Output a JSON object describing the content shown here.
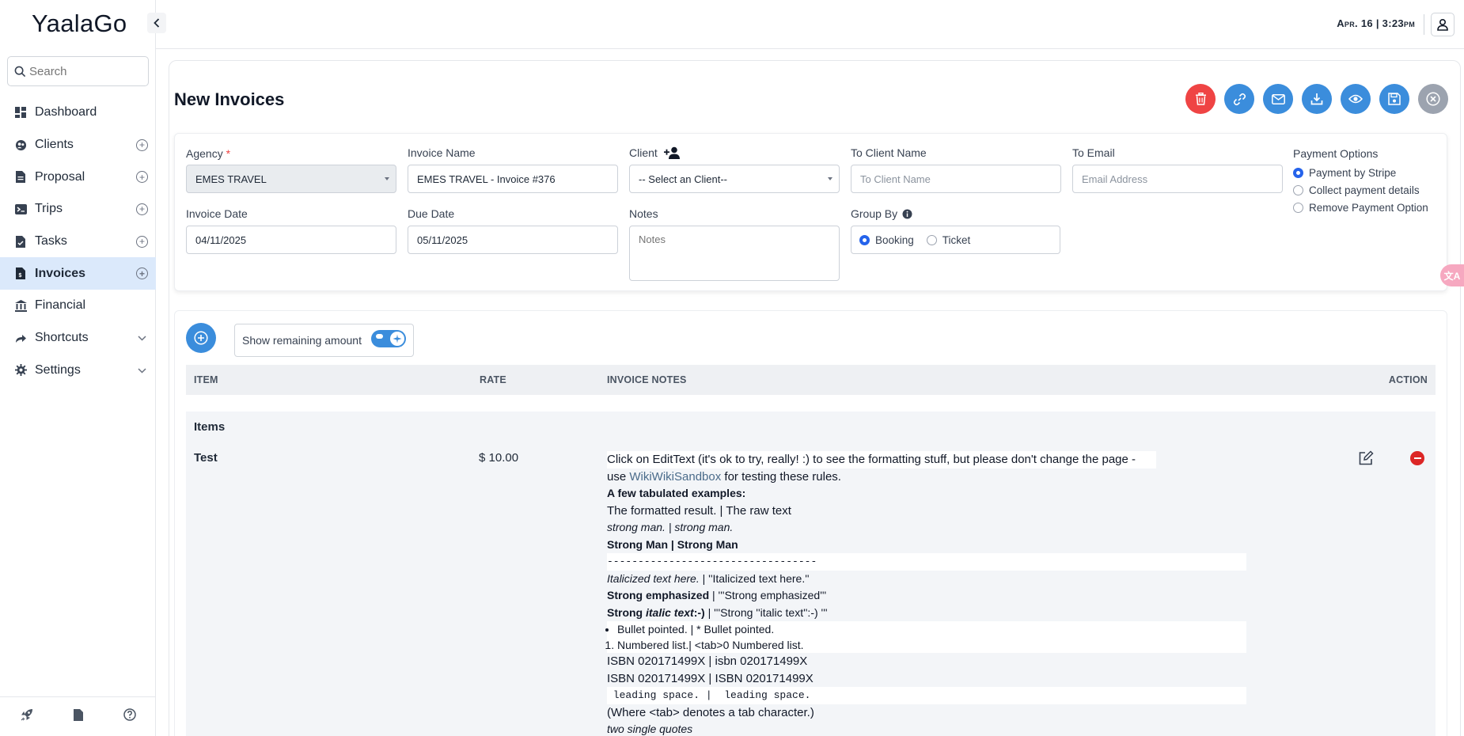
{
  "app": {
    "logo": "YaalaGo"
  },
  "search": {
    "placeholder": "Search"
  },
  "nav": [
    {
      "label": "Dashboard",
      "icon": "dashboard-icon",
      "has_plus": false
    },
    {
      "label": "Clients",
      "icon": "clients-icon",
      "has_plus": true
    },
    {
      "label": "Proposal",
      "icon": "proposal-icon",
      "has_plus": true
    },
    {
      "label": "Trips",
      "icon": "trips-icon",
      "has_plus": true
    },
    {
      "label": "Tasks",
      "icon": "tasks-icon",
      "has_plus": true
    },
    {
      "label": "Invoices",
      "icon": "invoices-icon",
      "has_plus": true,
      "active": true
    },
    {
      "label": "Financial",
      "icon": "financial-icon",
      "has_plus": false
    },
    {
      "label": "Shortcuts",
      "icon": "shortcuts-icon",
      "has_chevron": true
    },
    {
      "label": "Settings",
      "icon": "gear-icon",
      "has_chevron": true
    }
  ],
  "header": {
    "datetime": "Apr. 16 | 3:23pm"
  },
  "page": {
    "title": "New Invoices"
  },
  "actions": [
    "delete-icon",
    "link-icon",
    "email-icon",
    "download-icon",
    "preview-icon",
    "save-icon",
    "close-icon"
  ],
  "form": {
    "agency": {
      "label": "Agency",
      "required_mark": "*",
      "value": "EMES TRAVEL"
    },
    "invoice_name": {
      "label": "Invoice Name",
      "value": "EMES TRAVEL - Invoice #376"
    },
    "client": {
      "label": "Client",
      "value": "-- Select an Client--"
    },
    "to_client_name": {
      "label": "To Client Name",
      "placeholder": "To Client Name"
    },
    "to_email": {
      "label": "To Email",
      "placeholder": "Email Address"
    },
    "payment_options": {
      "label": "Payment Options",
      "options": [
        "Payment by Stripe",
        "Collect payment details",
        "Remove Payment Option"
      ],
      "selected": "Payment by Stripe"
    },
    "invoice_date": {
      "label": "Invoice Date",
      "value": "04/11/2025"
    },
    "due_date": {
      "label": "Due Date",
      "value": "05/11/2025"
    },
    "notes": {
      "label": "Notes",
      "placeholder": "Notes"
    },
    "group_by": {
      "label": "Group By",
      "options": [
        "Booking",
        "Ticket"
      ],
      "selected": "Booking"
    }
  },
  "items": {
    "show_remaining_label": "Show remaining amount",
    "show_remaining_on": true,
    "columns": {
      "item": "ITEM",
      "rate": "RATE",
      "notes": "INVOICE NOTES",
      "action": "ACTION"
    },
    "group_title": "Items",
    "row": {
      "name": "Test",
      "rate": "$ 10.00"
    },
    "notes": {
      "l1": "Click on EditText (it's ok to try, really! :) to see the formatting stuff, but please don't change the page -",
      "l2a": "use ",
      "l2link": "WikiWikiSandbox",
      "l2b": " for testing these rules.",
      "l3": "A few tabulated examples:",
      "l4": "The formatted result. | The raw text",
      "l5": "strong man. | strong man.",
      "l6": "Strong Man | Strong Man",
      "l7": " ----------------------------------",
      "l8a": "Italicized text here.",
      "l8b": " | ''Italicized text here.''",
      "l9a": "Strong emphasized",
      "l9b": " | '''Strong emphasized'''",
      "l10a": "Strong ",
      "l10b": "italic text",
      "l10c": ":-)",
      "l10d": " | '''Strong ''italic text'':-) '''",
      "l11": "Bullet pointed. | * Bullet pointed.",
      "l12": "Numbered list.| <tab>0 Numbered list.",
      "l13": "ISBN 020171499X | isbn 020171499X",
      "l14": "ISBN 020171499X | ISBN 020171499X",
      "l15": " leading space. |  leading space.",
      "l16": "(Where <tab> denotes a tab character.)",
      "l17": "two single quotes"
    }
  },
  "colors": {
    "accent": "#3b8ddc",
    "danger": "#ef4444",
    "active_nav": "#dbe9fb"
  }
}
